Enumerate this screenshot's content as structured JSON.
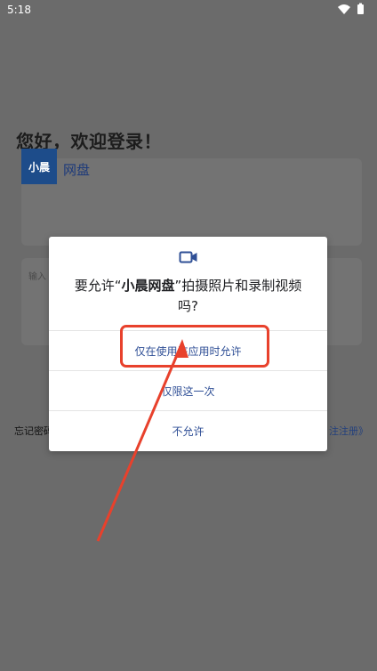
{
  "status_bar": {
    "time": "5:18"
  },
  "login": {
    "title": "您好，欢迎登录！",
    "logo_text": "小晨",
    "app_name": "网盘",
    "input_hint": "输入",
    "forgot_password": "忘记密码",
    "register_link": "注注册》"
  },
  "dialog": {
    "message_prefix": "要允许“",
    "app_name": "小晨网盘",
    "message_suffix": "”拍摄照片和录制视频吗?",
    "options": [
      {
        "label": "仅在使用该应用时允许"
      },
      {
        "label": "仅限这一次"
      },
      {
        "label": "不允许"
      }
    ]
  },
  "colors": {
    "annotation": "#e8412c",
    "option_text": "#2f4f96",
    "scrim": "#6b6b6b"
  }
}
